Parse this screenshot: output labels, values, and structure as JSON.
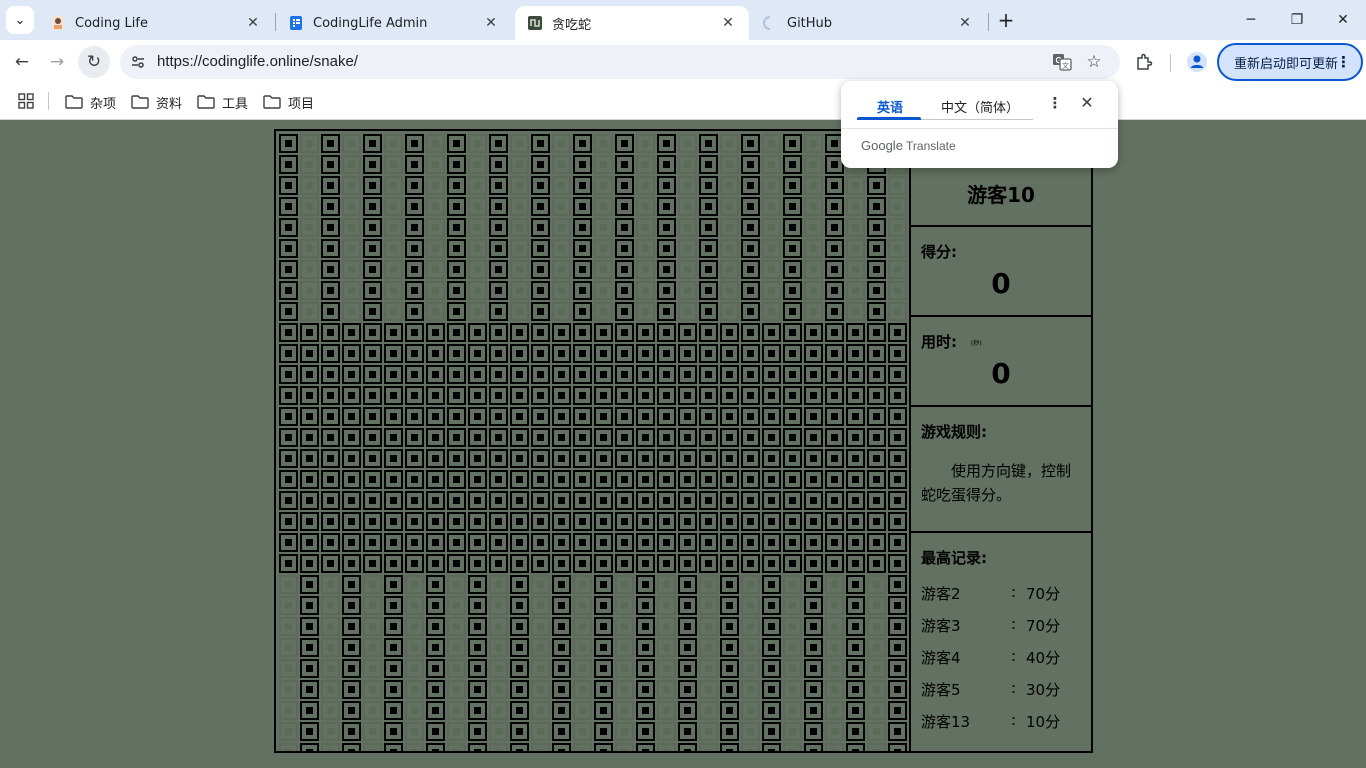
{
  "browser": {
    "tabs": [
      {
        "title": "Coding Life",
        "active": false
      },
      {
        "title": "CodingLife Admin",
        "active": false
      },
      {
        "title": "贪吃蛇",
        "active": true
      },
      {
        "title": "GitHub",
        "active": false
      }
    ],
    "url": "https://codinglife.online/snake/",
    "update_button": "重新启动即可更新",
    "bookmarks": [
      "杂项",
      "资料",
      "工具",
      "项目"
    ]
  },
  "translate_popup": {
    "source_lang": "英语",
    "target_lang": "中文（简体）",
    "brand": "Google",
    "brand_suffix": "Translate"
  },
  "game": {
    "player": "游客10",
    "score_label": "得分:",
    "score": "0",
    "time_label": "用时:",
    "time_unit": "(秒)",
    "time": "0",
    "rules_label": "游戏规则:",
    "rules_text": "使用方向键，控制蛇吃蛋得分。",
    "records_label": "最高记录:",
    "records": [
      {
        "name": "游客2",
        "colon": ":",
        "score": "70分"
      },
      {
        "name": "游客3",
        "colon": ":",
        "score": "70分"
      },
      {
        "name": "游客4",
        "colon": ":",
        "score": "40分"
      },
      {
        "name": "游客5",
        "colon": ":",
        "score": "30分"
      },
      {
        "name": "游客13",
        "colon": ":",
        "score": "10分"
      }
    ]
  },
  "colors": {
    "background": "#627161",
    "cell_on": "#000000",
    "cell_off": "#55624f",
    "accent": "#0b57d0"
  }
}
